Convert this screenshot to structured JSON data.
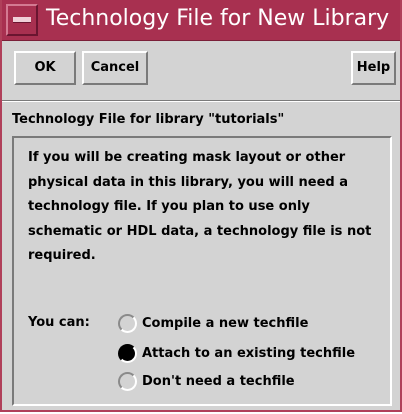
{
  "window": {
    "title": "Technology File for New Library"
  },
  "toolbar": {
    "ok_label": "OK",
    "cancel_label": "Cancel",
    "help_label": "Help"
  },
  "section": {
    "label": "Technology File for library \"tutorials\""
  },
  "description": {
    "text": "If you will be creating mask layout or other physical data in this library, you will need a technology file. If you plan to use only schematic or HDL data, a technology file is not required."
  },
  "options": {
    "prompt": "You can:",
    "selected": "Attach to an existing techfile",
    "items": [
      {
        "label": "Compile a new techfile",
        "checked": false
      },
      {
        "label": "Attach to an existing techfile",
        "checked": true
      },
      {
        "label": "Don't need a techfile",
        "checked": false
      }
    ]
  },
  "colors": {
    "title_bar": "#a83050",
    "window_bg": "#d3d3d3",
    "title_text": "#ffffff"
  },
  "icons": {
    "window_menu": "window-menu-icon"
  }
}
